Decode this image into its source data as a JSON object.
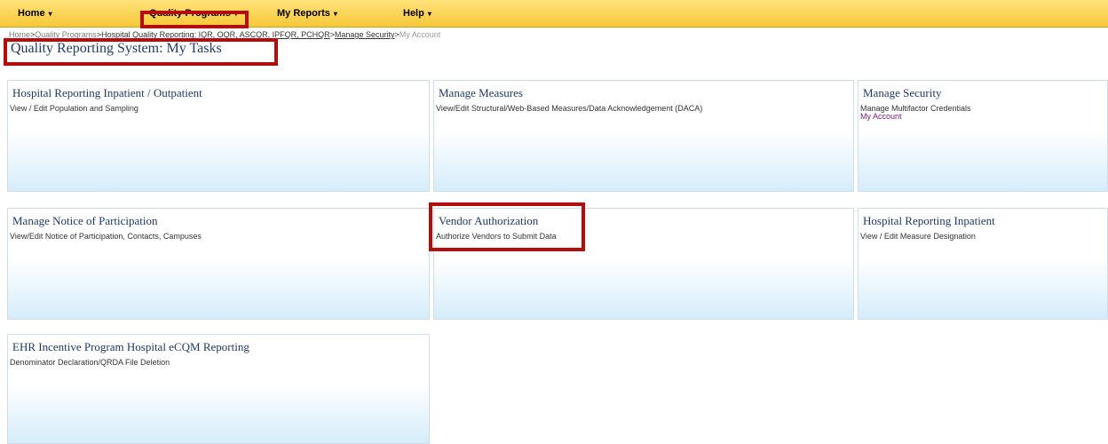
{
  "nav": {
    "home": "Home",
    "quality_programs": "Quality Programs",
    "my_reports": "My Reports",
    "help": "Help",
    "caret": "▾"
  },
  "breadcrumb": {
    "items": [
      "Home",
      "Quality Programs",
      "Hospital Quality Reporting: IQR, OQR, ASCQR, IPFQR, PCHQR",
      "Manage Security"
    ],
    "separator": ">",
    "current": "My Account"
  },
  "page_title": "Quality Reporting System: My Tasks",
  "tiles": [
    {
      "title": "Hospital Reporting Inpatient / Outpatient",
      "description": "View / Edit Population and Sampling"
    },
    {
      "title": "Manage Measures",
      "description": "View/Edit Structural/Web-Based Measures/Data Acknowledgement (DACA)"
    },
    {
      "title": "Manage Security",
      "description": "Manage Multifactor Credentials",
      "link": "My Account"
    },
    {
      "title": "Manage Notice of Participation",
      "description": "View/Edit Notice of Participation, Contacts, Campuses"
    },
    {
      "title": "Vendor Authorization",
      "description": "Authorize Vendors to Submit Data"
    },
    {
      "title": "Hospital Reporting Inpatient",
      "description": "View / Edit Measure Designation"
    },
    {
      "title": "EHR Incentive Program Hospital eCQM Reporting",
      "description": "Denominator Declaration/QRDA File Deletion"
    }
  ],
  "colors": {
    "nav_gradient_top": "#ffe27a",
    "nav_gradient_bottom": "#f7c838",
    "highlight_border": "#b30d0d",
    "title_text": "#1f3a64",
    "link_text": "#7a1a7a",
    "tile_gradient_bottom": "#d6ecfa"
  }
}
